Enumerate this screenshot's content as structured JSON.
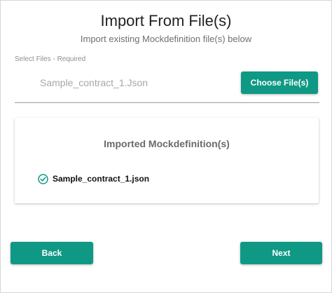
{
  "header": {
    "title": "Import From File(s)",
    "subtitle": "Import existing Mockdefinition file(s) below"
  },
  "file_select": {
    "label": "Select Files - Required",
    "value": "Sample_contract_1.Json",
    "choose_label": "Choose File(s)"
  },
  "imported": {
    "title": "Imported Mockdefinition(s)",
    "items": [
      {
        "name": "Sample_contract_1.json",
        "icon": "check-circle-icon"
      }
    ]
  },
  "actions": {
    "back_label": "Back",
    "next_label": "Next"
  },
  "colors": {
    "accent": "#0f9985",
    "check": "#0f9985"
  }
}
